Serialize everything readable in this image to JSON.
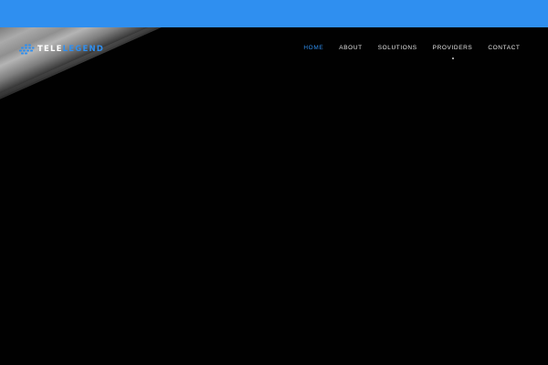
{
  "header": {
    "bar_color": "#2f8ff0",
    "logo": {
      "text_primary": "TELE",
      "text_secondary": "LEGEND",
      "icon": "globe-dots-icon",
      "accent_color": "#2f8ff0"
    },
    "nav": {
      "items": [
        {
          "label": "HOME",
          "active": true
        },
        {
          "label": "ABOUT",
          "active": false
        },
        {
          "label": "SOLUTIONS",
          "active": false
        },
        {
          "label": "PROVIDERS",
          "active": false
        },
        {
          "label": "CONTACT",
          "active": false
        }
      ]
    }
  },
  "hero": {
    "background_color": "#010101"
  }
}
